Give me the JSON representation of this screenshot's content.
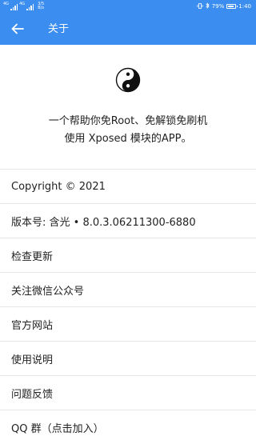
{
  "status_bar": {
    "sim1_label": "4G",
    "sim2_label": "4G",
    "net_speed_value": "3/5",
    "net_speed_unit": "B/s",
    "battery_percent": "79%",
    "battery_level": 0.79,
    "time": "1:40"
  },
  "app_bar": {
    "title": "关于",
    "background_color": "#3b8ef0"
  },
  "about": {
    "logo_icon": "yin-yang-icon",
    "description_line1": "一个帮助你免Root、免解锁免刷机",
    "description_line2": "使用 Xposed 模块的APP。"
  },
  "menu": {
    "items": [
      {
        "label": "Copyright © 2021"
      },
      {
        "label": "版本号: 含光 • 8.0.3.06211300-6880"
      },
      {
        "label": "检查更新"
      },
      {
        "label": "关注微信公众号"
      },
      {
        "label": "官方网站"
      },
      {
        "label": "使用说明"
      },
      {
        "label": "问题反馈"
      },
      {
        "label": "QQ 群（点击加入）"
      }
    ]
  }
}
